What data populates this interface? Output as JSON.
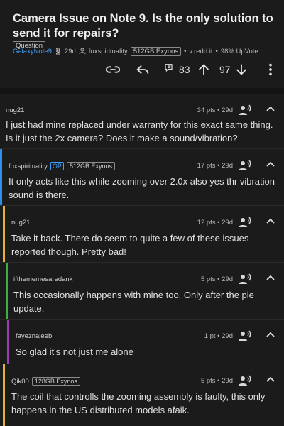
{
  "post": {
    "title": "Camera Issue on Note 9. Is the only solution to send it for repairs?",
    "flair": "Question",
    "subreddit": "GalaxyNote9",
    "age": "29d",
    "author": "foxspirituality",
    "author_flair": "512GB Exynos",
    "sep1": "•",
    "domain": "v.redd.it",
    "sep2": "•",
    "upvote_ratio": "98% UpVote",
    "comment_count": "83",
    "score": "97"
  },
  "comments": [
    {
      "user": "nug21",
      "op": "",
      "flair": "",
      "meta": "34 pts • 29d",
      "body": "I just had mine replaced under warranty for this exact same thing. Is it just the 2x camera? Does it make a sound/vibration?"
    },
    {
      "user": "foxspirituality",
      "op": "OP",
      "flair": "512GB Exynos",
      "meta": "17 pts • 29d",
      "body": "It only acts like this while zooming over 2.0x also yes thr vibration sound is there."
    },
    {
      "user": "nug21",
      "op": "",
      "flair": "",
      "meta": "12 pts • 29d",
      "body": "Take it back. There do seem to quite a few of these issues reported though. Pretty bad!"
    },
    {
      "user": "ifthememesaredank",
      "op": "",
      "flair": "",
      "meta": "5 pts • 29d",
      "body": "This occasionally happens with mine too. Only after the pie update."
    },
    {
      "user": "fayeznajeeb",
      "op": "",
      "flair": "",
      "meta": "1 pt • 29d",
      "body": "So glad it's not just me alone"
    },
    {
      "user": "Qik00",
      "op": "",
      "flair": "128GB Exynos",
      "meta": "5 pts • 29d",
      "body": "The coil that controlls the zooming assembly is faulty, this only happens in the US distributed models afaik."
    }
  ],
  "colors": {
    "accent": "#3aa0ff",
    "depth_bars": [
      "#2f8fe6",
      "#e0b43a",
      "#3fae4a",
      "#9b3fb0",
      "#e0b43a"
    ]
  },
  "icons": {
    "post_actions": [
      "link-icon",
      "reply-icon",
      "comments-icon",
      "upvote-icon",
      "downvote-icon",
      "more-icon"
    ],
    "comment": [
      "speaker-icon",
      "collapse-chevron-icon"
    ]
  }
}
